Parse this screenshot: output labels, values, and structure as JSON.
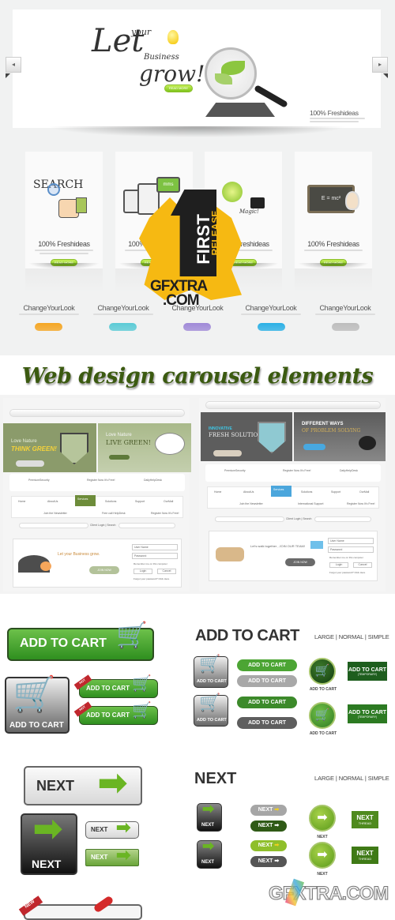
{
  "hero": {
    "headline_line1": "Let",
    "headline_line2": "your",
    "headline_line3": "Business",
    "headline_line4": "grow!",
    "button_label": "READ MORE",
    "caption_title": "100% Freshideas",
    "prev_arrow": "◂",
    "next_arrow": "▸"
  },
  "cards": [
    {
      "icon_text": "SEARCH",
      "title": "100% Freshideas",
      "button": "READ MORE"
    },
    {
      "icon_text": "mms",
      "title": "100% Freshideas",
      "button": "READ MORE"
    },
    {
      "icon_text": "Magic!",
      "title": "100% Freshideas",
      "button": "READ MORE"
    },
    {
      "icon_text": "E = mc²",
      "title": "100% Freshideas",
      "button": "READ MORE"
    }
  ],
  "change_row": [
    {
      "title": "ChangeYourLook",
      "color": "#f5a623"
    },
    {
      "title": "ChangeYourLook",
      "color": "#5ccbd6"
    },
    {
      "title": "ChangeYourLook",
      "color": "#a08ad8"
    },
    {
      "title": "ChangeYourLook",
      "color": "#2bb0e6"
    },
    {
      "title": "ChangeYourLook",
      "color": "#bdbdbd"
    }
  ],
  "badge": {
    "number": "1",
    "line1": "FIRST",
    "line2": "RELEASE",
    "site1": "GFXTRA",
    "site2": ".COM"
  },
  "page_title": "Web design carousel elements",
  "templates": [
    {
      "theme_color": "#8a9a6a",
      "slide1_kicker": "Love Nature",
      "slide1_title": "THINK GREEN!",
      "slide2_kicker": "Love Nature",
      "slide2_title": "LIVE GREEN!",
      "features": [
        "PremiumSecurity",
        "Register Now It's Free!",
        "DailyHelpDesk"
      ],
      "nav": [
        "Home",
        "AboutUs",
        "Services",
        "Solutions",
        "Support",
        "OurMail"
      ],
      "subfeatures": [
        "Join the Newsletter",
        "Free call HelpDesk",
        "Register Now It's Free!"
      ],
      "login_links": "Client Login | Search",
      "promo": "Let your Business grow.",
      "join_button": "JOIN NOW",
      "username": "User Name",
      "password": "Password",
      "remember": "Remember me on this computer",
      "login": "Login",
      "cancel": "Cancel",
      "forgot": "Forgot your password? Click Here"
    },
    {
      "theme_color": "#5f5f5f",
      "slide1_kicker": "INNOVATIVE",
      "slide1_title": "FRESH SOLUTIONS",
      "slide2_kicker": "DIFFERENT WAYS",
      "slide2_title": "OF PROBLEM SOLVING",
      "features": [
        "PremiumSecurity",
        "Register Now It's Free!",
        "DailyHelpDesk"
      ],
      "nav": [
        "Home",
        "AboutUs",
        "Services",
        "Solutions",
        "Support",
        "OurMail"
      ],
      "subfeatures": [
        "Join the Newsletter",
        "International Support",
        "Register Now It's Free!"
      ],
      "login_links": "Client Login | Search",
      "promo": "Let's walk together , JOIN OUR TEAM!",
      "join_button": "JOIN NOW",
      "username": "User Name",
      "password": "Password",
      "remember": "Remember me on this computer",
      "login": "Login",
      "cancel": "Cancel",
      "forgot": "Forgot your password? Click Here"
    }
  ],
  "cart": {
    "big_label": "ADD TO CART",
    "box_label": "ADD TO CART",
    "hot": "HOT",
    "heading": "ADD TO CART",
    "sizes": "LARGE | NORMAL | SIMPLE",
    "pill_label": "ADD TO CART",
    "circle_caption": "ADD TO CART",
    "temp_label": "ADD TO CART",
    "temp_sub": "(TEMPORARY)",
    "cart_icon": "🛒"
  },
  "next": {
    "big_label": "NEXT",
    "heading": "NEXT",
    "sizes": "LARGE | NORMAL | SIMPLE",
    "pill_label": "NEXT",
    "circle_caption": "NEXT",
    "thread_label": "NEXT",
    "thread_sub": "THREAD",
    "arrow": "➡",
    "new_ribbon": "NEW"
  },
  "watermark": "GFXTRA.COM"
}
